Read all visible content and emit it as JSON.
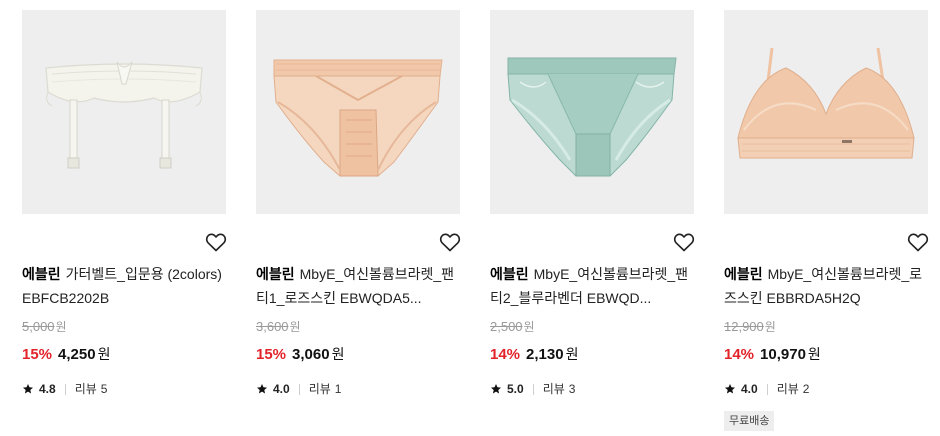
{
  "products": [
    {
      "image_name": "garter-belt-image",
      "brand": "에블린",
      "name": "가터벨트_입문용 (2colors) EBFCB2202B",
      "original_price": "5,000",
      "discount_rate": "15%",
      "price": "4,250",
      "currency": "원",
      "rating": "4.8",
      "review_label": "리뷰",
      "review_count": "5",
      "badge": ""
    },
    {
      "image_name": "panty-roseskin-image",
      "brand": "에블린",
      "name": "MbyE_여신볼륨브라렛_팬티1_로즈스킨 EBWQDA5...",
      "original_price": "3,600",
      "discount_rate": "15%",
      "price": "3,060",
      "currency": "원",
      "rating": "4.0",
      "review_label": "리뷰",
      "review_count": "1",
      "badge": ""
    },
    {
      "image_name": "panty-bluelavender-image",
      "brand": "에블린",
      "name": "MbyE_여신볼륨브라렛_팬티2_블루라벤더 EBWQD...",
      "original_price": "2,500",
      "discount_rate": "14%",
      "price": "2,130",
      "currency": "원",
      "rating": "5.0",
      "review_label": "리뷰",
      "review_count": "3",
      "badge": ""
    },
    {
      "image_name": "bralette-roseskin-image",
      "brand": "에블린",
      "name": "MbyE_여신볼륨브라렛_로즈스킨 EBBRDA5H2Q",
      "original_price": "12,900",
      "discount_rate": "14%",
      "price": "10,970",
      "currency": "원",
      "rating": "4.0",
      "review_label": "리뷰",
      "review_count": "2",
      "badge": "무료배송"
    }
  ],
  "colors": {
    "discount": "#e2232a",
    "strike": "#9a9a9a",
    "thumb_bg": "#eeeeee",
    "peach": "#f1c9aa",
    "mint": "#9fc8bd",
    "ivory": "#f4f3ec"
  }
}
